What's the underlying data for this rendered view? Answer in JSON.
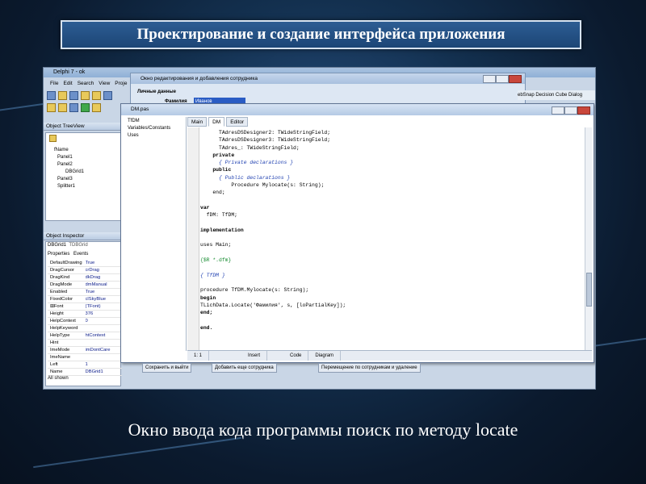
{
  "slide": {
    "title": "Проектирование и создание интерфейса приложения",
    "caption": "Окно ввода кода программы поиск по методу locate"
  },
  "delphi": {
    "window_title": "Delphi 7 - ok",
    "menu": [
      "File",
      "Edit",
      "Search",
      "View",
      "Proje"
    ],
    "palette_text": "ebSnap  Decision Cube  Dialog"
  },
  "tree_view": {
    "title": "Object TreeView",
    "items": [
      "fName",
      "Panel1",
      "Panel2",
      "DBGrid1",
      "Panel3",
      "Splitter1"
    ]
  },
  "object_inspector": {
    "title": "Object Inspector",
    "selected_object": "DBGrid1",
    "selected_type": "TDBGrid",
    "tabs": [
      "Properties",
      "Events"
    ],
    "rows": [
      {
        "k": "DefaultDrawing",
        "v": "True"
      },
      {
        "k": "DragCursor",
        "v": "crDrag"
      },
      {
        "k": "DragKind",
        "v": "dkDrag"
      },
      {
        "k": "DragMode",
        "v": "dmManual"
      },
      {
        "k": "Enabled",
        "v": "True"
      },
      {
        "k": "FixedColor",
        "v": "clSkyBlue"
      },
      {
        "k": "⊞Font",
        "v": "(TFont)"
      },
      {
        "k": "Height",
        "v": "376"
      },
      {
        "k": "HelpContext",
        "v": "0"
      },
      {
        "k": "HelpKeyword",
        "v": ""
      },
      {
        "k": "HelpType",
        "v": "htContext"
      },
      {
        "k": "Hint",
        "v": ""
      },
      {
        "k": "ImeMode",
        "v": "imDontCare"
      },
      {
        "k": "ImeName",
        "v": ""
      },
      {
        "k": "Left",
        "v": "1"
      },
      {
        "k": "Name",
        "v": "DBGrid1"
      }
    ],
    "status": "All shown"
  },
  "form_designer": {
    "title": "Окно редактирования и добавления сотрудника",
    "group_label": "Личные данные",
    "field_label": "Фамилия",
    "field_value": "Иванов"
  },
  "editor": {
    "title": "DM.pas",
    "tree": [
      "TfDM",
      "Variables/Constants",
      "Uses"
    ],
    "tabs": [
      "Main",
      "DM",
      "Editor"
    ],
    "code_lines": [
      {
        "t": "      TAdresDSDesigner2: TWideStringField;",
        "c": ""
      },
      {
        "t": "      TAdresDSDesigner3: TWideStringField;",
        "c": ""
      },
      {
        "t": "      TAdres_: TWideStringField;",
        "c": ""
      },
      {
        "t": "    private",
        "c": "kw"
      },
      {
        "t": "      { Private declarations }",
        "c": "cm"
      },
      {
        "t": "    public",
        "c": "kw"
      },
      {
        "t": "      { Public declarations }",
        "c": "cm"
      },
      {
        "t": "          Procedure Mylocate(s: String);",
        "c": ""
      },
      {
        "t": "    end;",
        "c": ""
      },
      {
        "t": "",
        "c": ""
      },
      {
        "t": "var",
        "c": "kw"
      },
      {
        "t": "  fDM: TfDM;",
        "c": ""
      },
      {
        "t": "",
        "c": ""
      },
      {
        "t": "implementation",
        "c": "kw"
      },
      {
        "t": "",
        "c": ""
      },
      {
        "t": "uses Main;",
        "c": ""
      },
      {
        "t": "",
        "c": ""
      },
      {
        "t": "{$R *.dfm}",
        "c": "dir"
      },
      {
        "t": "",
        "c": ""
      },
      {
        "t": "{ TfDM }",
        "c": "cm"
      },
      {
        "t": "",
        "c": ""
      },
      {
        "t": "procedure TfDM.Mylocate(s: String);",
        "c": ""
      },
      {
        "t": "begin",
        "c": "kw"
      },
      {
        "t": "TLichData.Locate('Фамилия', s, [loPartialKey]);",
        "c": ""
      },
      {
        "t": "end;",
        "c": "kw"
      },
      {
        "t": "",
        "c": ""
      },
      {
        "t": "end.",
        "c": "kw"
      }
    ],
    "status": [
      "1: 1",
      "Insert"
    ],
    "bottom_tabs": [
      "Code",
      "Diagram"
    ]
  },
  "bottom_buttons": [
    "Сохранить и выйти",
    "Добавить еще сотрудника",
    "Перемещение по сотрудникам и удаление"
  ]
}
